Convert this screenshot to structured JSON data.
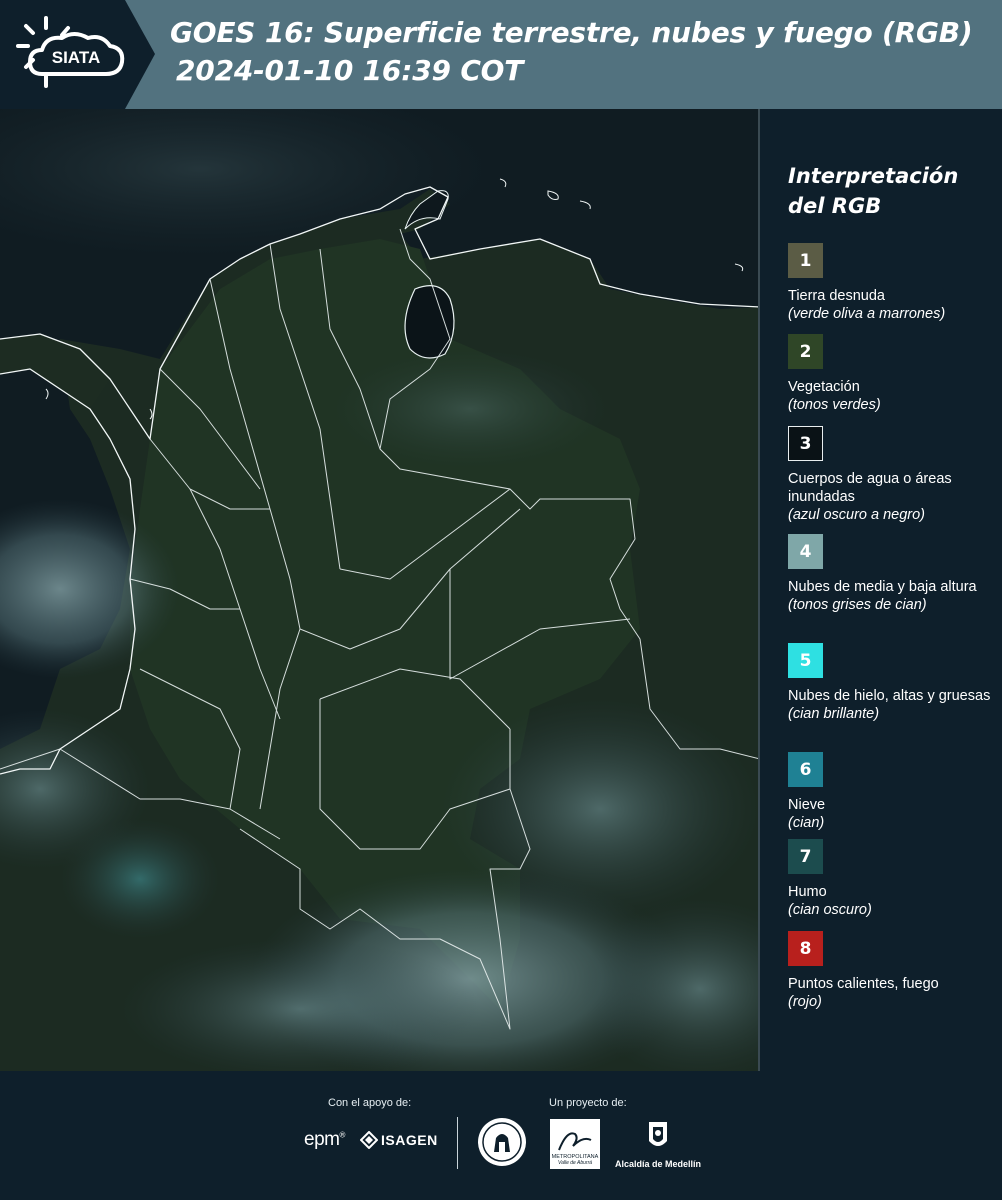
{
  "header": {
    "logo_text": "SIATA",
    "title_line1": "GOES 16: Superficie terrestre, nubes y fuego (RGB)",
    "title_line2": "2024-01-10 16:39 COT",
    "colors": {
      "banner": "#52727f",
      "logo_panel": "#0e1f2b",
      "background": "#0e1f2b"
    }
  },
  "legend": {
    "title": "Interpretación del RGB",
    "items": [
      {
        "num": "1",
        "label": "Tierra desnuda",
        "sub": "(verde oliva a marrones)",
        "color": "#5b5c45"
      },
      {
        "num": "2",
        "label": "Vegetación",
        "sub": "(tonos verdes)",
        "color": "#2f4627"
      },
      {
        "num": "3",
        "label": "Cuerpos de agua o áreas inundadas",
        "sub": "(azul oscuro a negro)",
        "color": "#0a1216"
      },
      {
        "num": "4",
        "label": "Nubes de media y baja altura",
        "sub": "(tonos grises de cian)",
        "color": "#7fa7a8"
      },
      {
        "num": "5",
        "label": "Nubes de hielo, altas y gruesas",
        "sub": "(cian brillante)",
        "color": "#2ee0e2"
      },
      {
        "num": "6",
        "label": "Nieve",
        "sub": "(cian)",
        "color": "#1f8194"
      },
      {
        "num": "7",
        "label": "Humo",
        "sub": "(cian oscuro)",
        "color": "#1c4c4e"
      },
      {
        "num": "8",
        "label": "Puntos calientes, fuego",
        "sub": "(rojo)",
        "color": "#b8201d"
      }
    ]
  },
  "footer": {
    "support_caption": "Con el apoyo de:",
    "project_caption": "Un proyecto de:",
    "sponsors": [
      "epm",
      "ISAGEN"
    ],
    "partners": [
      "METROPOLITANA",
      "Valle de Aburrá",
      "Alcaldía de Medellín"
    ]
  }
}
